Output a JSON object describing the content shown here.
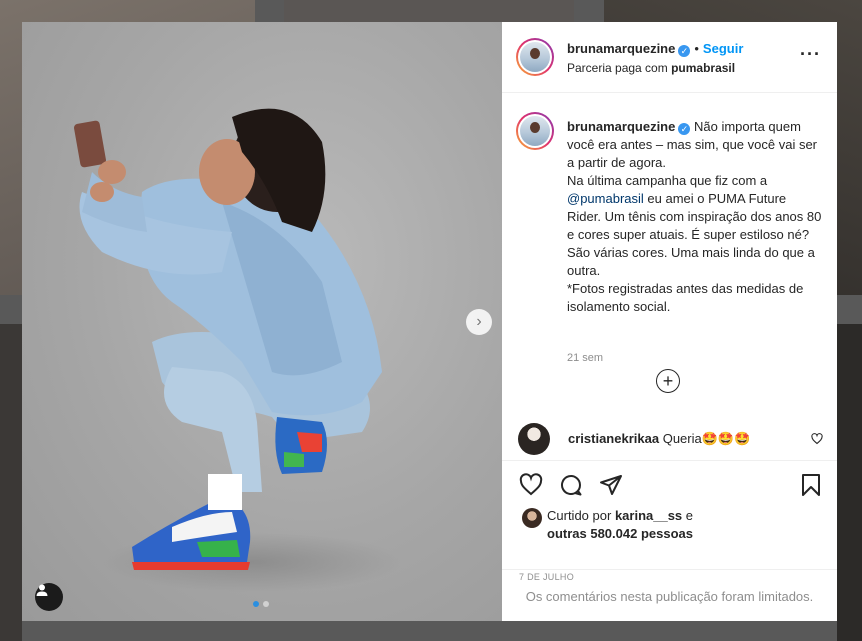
{
  "post": {
    "username": "bruna­marquezine",
    "verified_mark": "✓",
    "follow_label": "Seguir",
    "separator": "•",
    "partnership_prefix": "Parceria paga com",
    "partner": "pumabrasil",
    "more_label": "···"
  },
  "caption": {
    "username": "brunamarquezine",
    "line1": "Não importa quem você era antes – mas sim, que você vai ser a partir de agora.",
    "line2": "Na última campanha que fiz com a",
    "mention": "@pumabrasil",
    "line3": "eu amei o PUMA Future Rider. Um tênis com inspiração dos anos 80 e cores super atuais. É super estiloso né? São várias cores. Uma mais linda do que a outra.",
    "line4": "*Fotos registradas antes das medidas de isolamento social.",
    "time_ago": "21 sem"
  },
  "load_more_label": "+",
  "comment": {
    "username": "cristianekrikaa",
    "text": "Queria🤩🤩🤩"
  },
  "likes": {
    "prefix": "Curtido por",
    "user": "karina__ss",
    "and": "e",
    "others": "outras 580.042 pessoas"
  },
  "date": "7 DE JULHO",
  "comments_limited": "Os comentários nesta publicação foram limitados.",
  "carousel": {
    "current": 1,
    "total": 2,
    "next_label": "›"
  },
  "colors": {
    "accent": "#0095f6",
    "text": "#262626",
    "muted": "#8e8e8e",
    "active_dot": "#2b8fe0"
  }
}
